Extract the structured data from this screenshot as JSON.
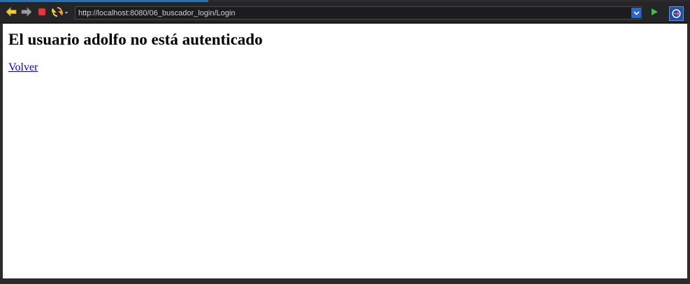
{
  "browser": {
    "url": "http://localhost:8080/06_buscador_login/Login",
    "icons": {
      "back": "arrow-left-icon",
      "forward": "arrow-right-icon",
      "stop": "stop-icon",
      "refresh": "refresh-icon",
      "dropdown": "chevron-down-icon",
      "go": "play-icon",
      "home": "browser-home-icon"
    },
    "colors": {
      "accent": "#2f6ea8",
      "back_arrow": "#f2c84b",
      "stop": "#e03a3a",
      "go": "#4cb848",
      "dropdown": "#2a64d6"
    }
  },
  "page": {
    "heading": "El usuario adolfo no está autenticado",
    "link_label": "Volver",
    "link_color": "#0000ee"
  }
}
